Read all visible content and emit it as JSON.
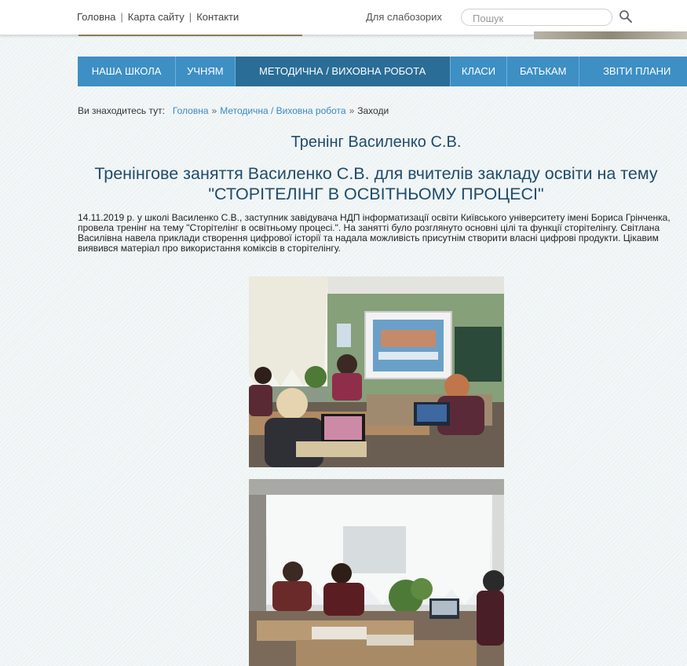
{
  "topbar": {
    "links": [
      "Головна",
      "Карта сайту",
      "Контакти"
    ],
    "vision_link": "Для слабозорих",
    "search_placeholder": "Пошук"
  },
  "nav": {
    "items": [
      "НАША ШКОЛА",
      "УЧНЯМ",
      "МЕТОДИЧНА / ВИХОВНА РОБОТА",
      "КЛАСИ",
      "БАТЬКАМ",
      "ЗВІТИ ПЛАНИ"
    ],
    "active_index": 2
  },
  "breadcrumb": {
    "prefix": "Ви знаходитесь тут:",
    "items": [
      "Головна",
      "Методична / Виховна робота"
    ],
    "separator": "»",
    "current": "Заходи"
  },
  "article": {
    "page_title": "Тренінг Василенко С.В.",
    "title_line1": "Тренінгове заняття Василенко С.В. для вчителів закладу освіти на тему",
    "title_line2": "\"СТОРІТЕЛІНГ В ОСВІТНЬОМУ ПРОЦЕСІ\"",
    "text": "14.11.2019 р. у школі Василенко С.В., заступник завідувача НДП інформатизації освіти Київського університету імені Бориса Грінченка, провела тренінг на тему \"Сторітелінг в освітньому процесі.\". На занятті було розглянуто основні цілі та функції сторітелінгу. Світлана Василівна навела приклади створення цифрової історії та надала можливість присутнім створити власні цифрові продукти. Цікавим виявився матеріал про використання коміксів в сторітелінгу."
  },
  "colors": {
    "nav_bg": "#3d8fc4",
    "nav_active": "#2a6d97",
    "title": "#1f4c6b",
    "link": "#3a8ac0"
  }
}
